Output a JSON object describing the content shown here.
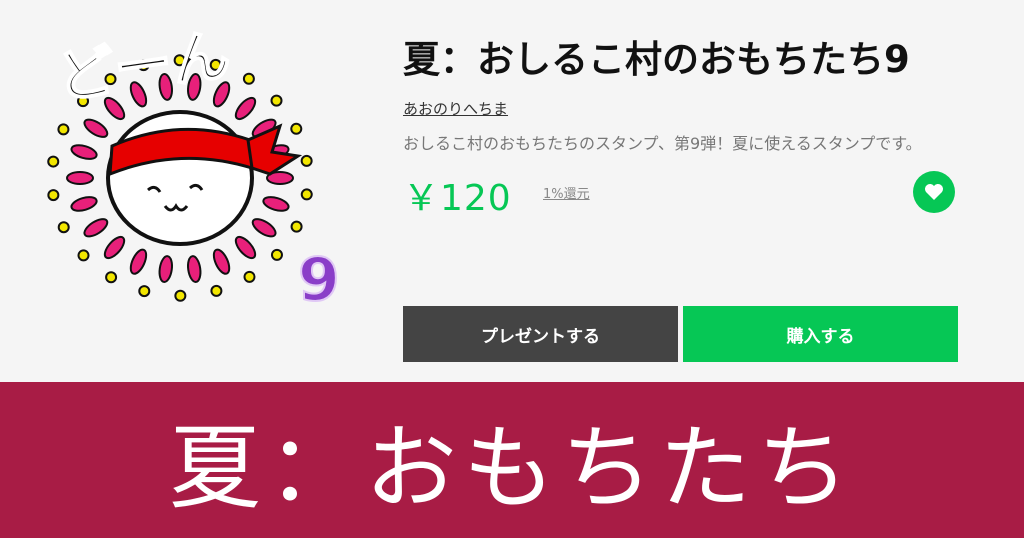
{
  "product": {
    "title": "夏：おしるこ村のおもちたち9",
    "author": "あおのりへちま",
    "description": "おしるこ村のおもちたちのスタンプ、第9弾！夏に使えるスタンプです。",
    "price": "￥120",
    "cashback": "1%還元"
  },
  "sticker": {
    "text": "どーん",
    "number": "9"
  },
  "buttons": {
    "gift": "プレゼントする",
    "buy": "購入する"
  },
  "banner": {
    "text": "夏：おもちたち"
  },
  "colors": {
    "accent": "#06c755",
    "banner": "#a81c45",
    "gift_button": "#444444",
    "headband": "#e60000",
    "burst": "#e8207a"
  },
  "icons": {
    "favorite": "heart-icon"
  }
}
